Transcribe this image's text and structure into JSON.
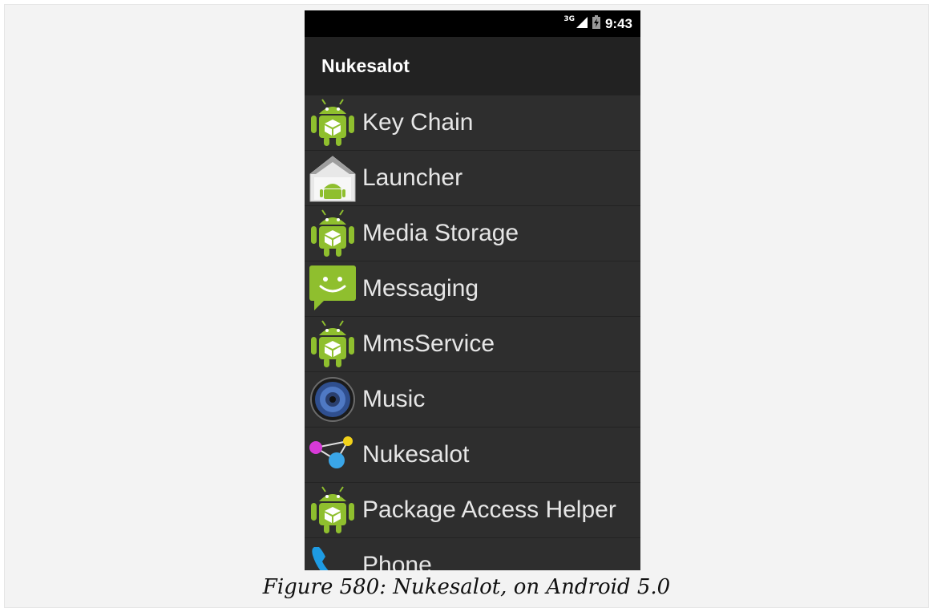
{
  "status_bar": {
    "network": "3G",
    "time": "9:43",
    "icons": [
      "signal-icon",
      "battery-charging-icon"
    ]
  },
  "action_bar": {
    "title": "Nukesalot"
  },
  "apps": [
    {
      "label": "Key Chain",
      "icon": "android-package-icon"
    },
    {
      "label": "Launcher",
      "icon": "launcher-home-icon"
    },
    {
      "label": "Media Storage",
      "icon": "android-package-icon"
    },
    {
      "label": "Messaging",
      "icon": "messaging-icon"
    },
    {
      "label": "MmsService",
      "icon": "android-package-icon"
    },
    {
      "label": "Music",
      "icon": "music-speaker-icon"
    },
    {
      "label": "Nukesalot",
      "icon": "nukesalot-molecule-icon"
    },
    {
      "label": "Package Access Helper",
      "icon": "android-package-icon"
    },
    {
      "label": "Phone",
      "icon": "phone-handset-icon"
    }
  ],
  "caption": "Figure 580: Nukesalot, on Android 5.0",
  "colors": {
    "status_bar": "#000000",
    "action_bar": "#222222",
    "list_background": "#2e2e2e",
    "android_green": "#8fbf2e"
  }
}
